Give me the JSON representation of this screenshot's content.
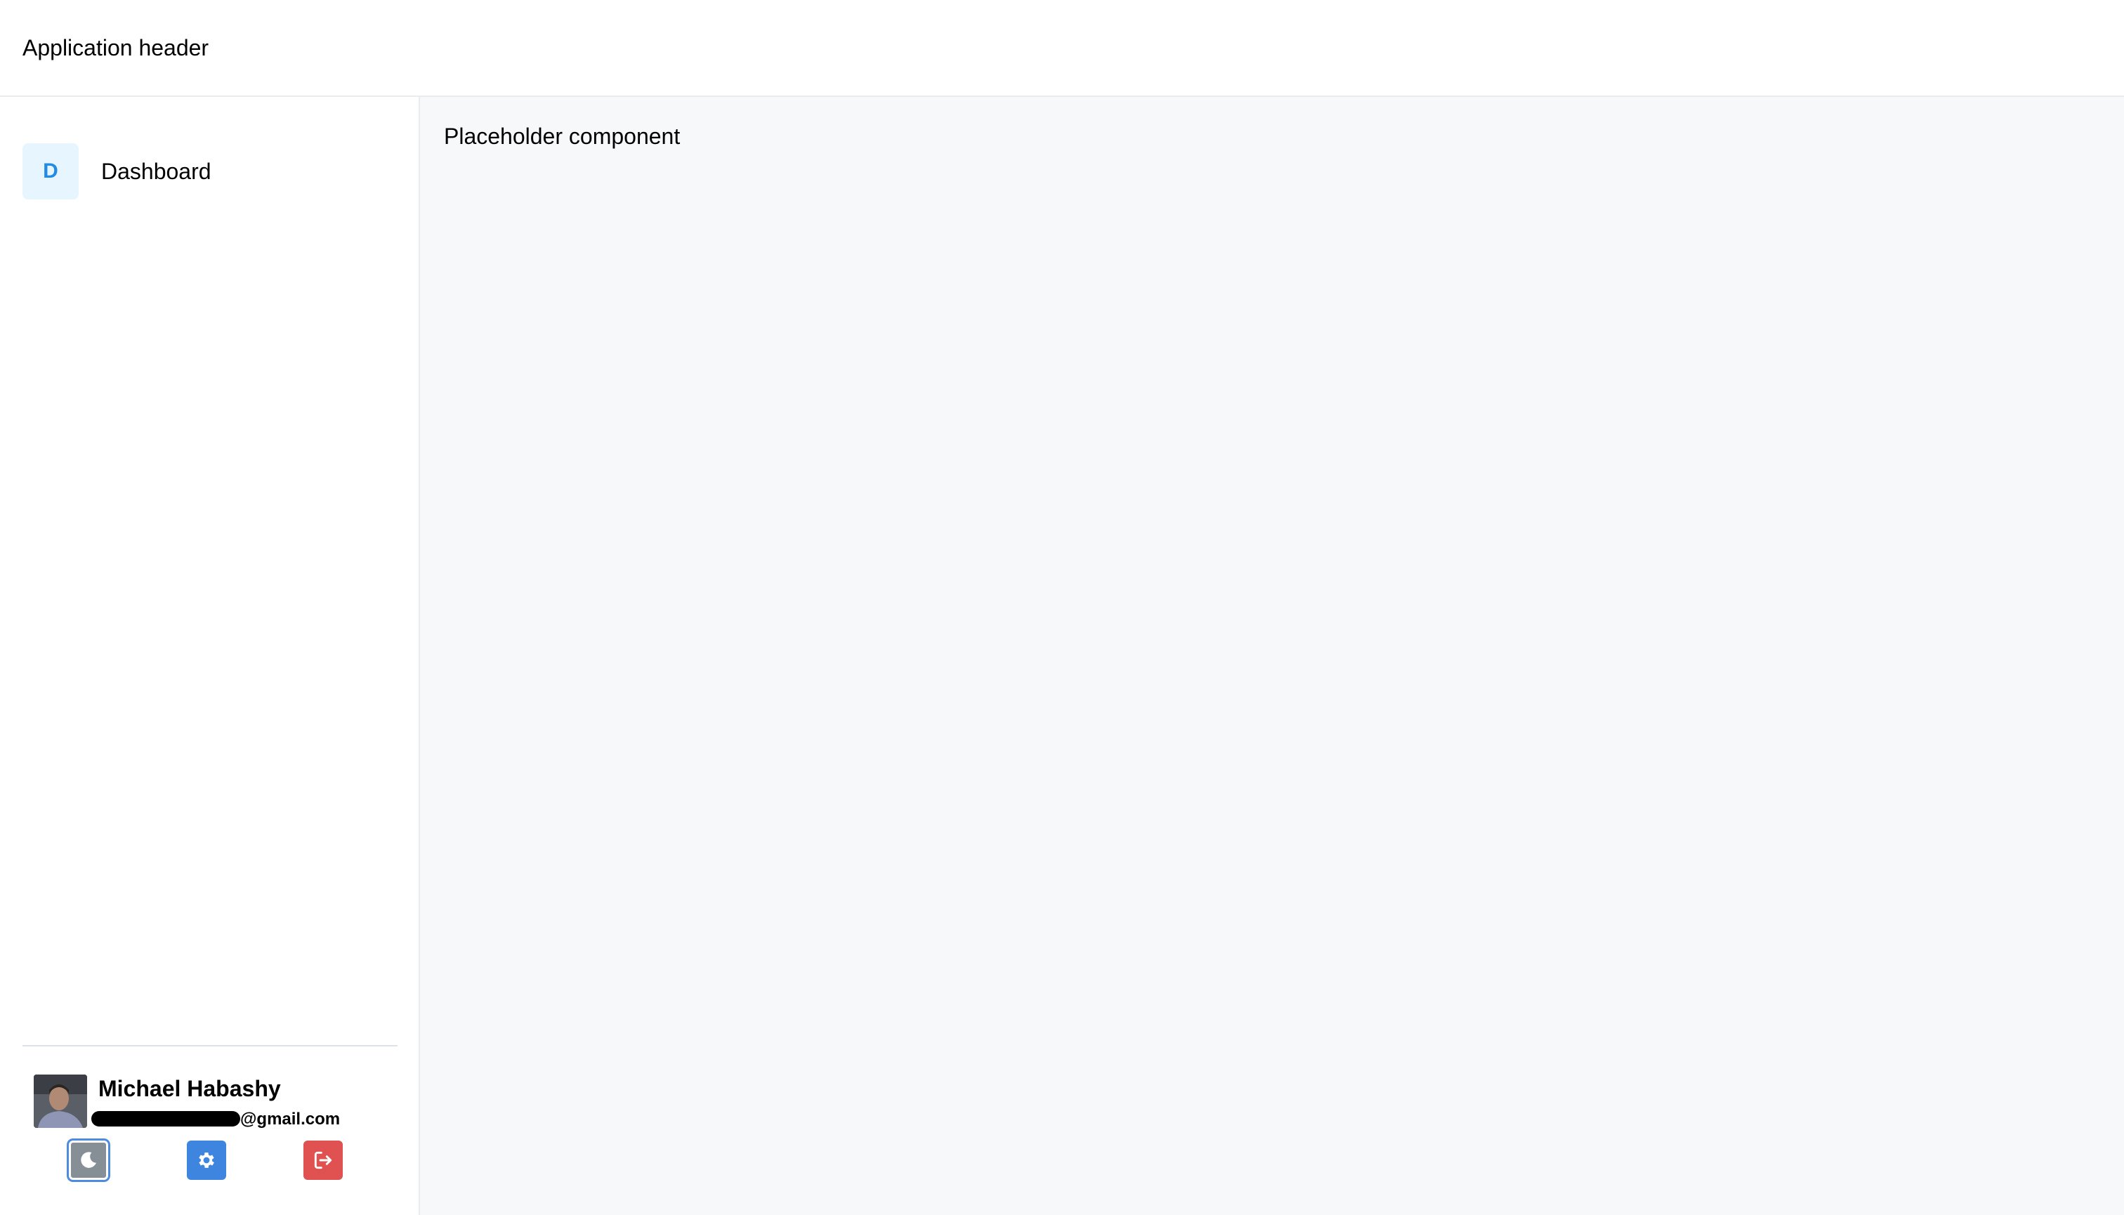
{
  "header": {
    "title": "Application header"
  },
  "sidebar": {
    "items": [
      {
        "letter": "D",
        "label": "Dashboard"
      }
    ],
    "user": {
      "name": "Michael Habashy",
      "email_visible": "@gmail.com"
    },
    "actions": [
      {
        "name": "theme-toggle",
        "icon": "moon-icon"
      },
      {
        "name": "settings",
        "icon": "gear-icon"
      },
      {
        "name": "logout",
        "icon": "logout-icon"
      }
    ]
  },
  "main": {
    "placeholder_text": "Placeholder component"
  },
  "colors": {
    "accent": "#228be6",
    "settings_button": "#3d85de",
    "logout_button": "#e05252",
    "theme_button": "#868e96",
    "main_background": "#f7f8fa"
  }
}
